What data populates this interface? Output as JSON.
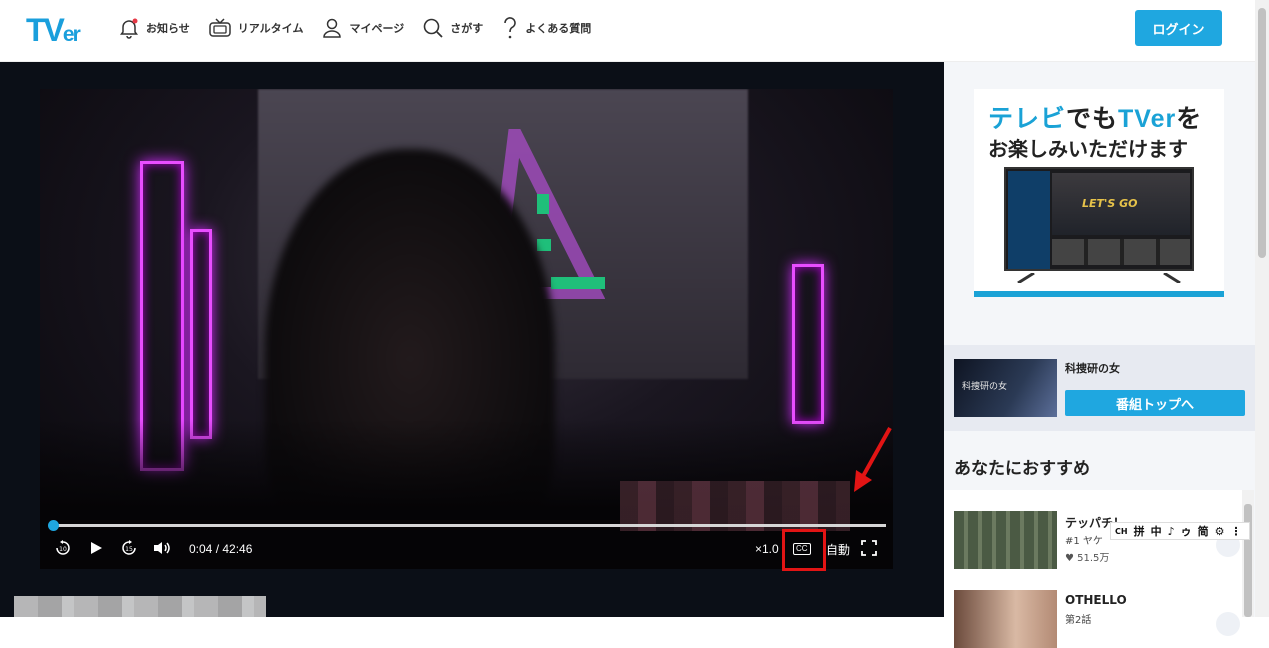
{
  "header": {
    "logo_big": "TV",
    "logo_small": "er",
    "nav": [
      {
        "label": "お知らせ",
        "icon": "bell-icon"
      },
      {
        "label": "リアルタイム",
        "icon": "tv-icon"
      },
      {
        "label": "マイページ",
        "icon": "user-icon"
      },
      {
        "label": "さがす",
        "icon": "search-icon"
      },
      {
        "label": "よくある質問",
        "icon": "question-icon"
      }
    ],
    "login_label": "ログイン"
  },
  "player": {
    "progress": 0.002,
    "current_time": "0:04",
    "separator": " / ",
    "duration": "42:46",
    "speed_label": "×1.0",
    "quality_label": "自動",
    "cc_label": "CC",
    "rewind_label": "10",
    "forward_label": "15"
  },
  "sidebar": {
    "ad": {
      "line1_a": "テレビ",
      "line1_b": "でも",
      "line1_c": "TVer",
      "line1_d": "を",
      "line2": "お楽しみいただけます",
      "tv_title": "LET'S GO"
    },
    "program": {
      "thumb_text": "科捜研の女",
      "title": "科捜研の女",
      "button_label": "番組トップへ"
    },
    "recommend_heading": "あなたにおすすめ",
    "recommendations": [
      {
        "title": "テッパチ！",
        "subtitle": "#1 ヤケ",
        "likes": "51.5万"
      },
      {
        "title": "OTHELLO",
        "subtitle": "第2話",
        "likes": ""
      }
    ]
  },
  "extension_toolbar": {
    "items": [
      "CH",
      "拼",
      "中",
      "♪",
      "ゥ",
      "简",
      "⚙",
      "⋮"
    ]
  },
  "colors": {
    "brand": "#1fa7e0",
    "highlight": "#e21414"
  }
}
